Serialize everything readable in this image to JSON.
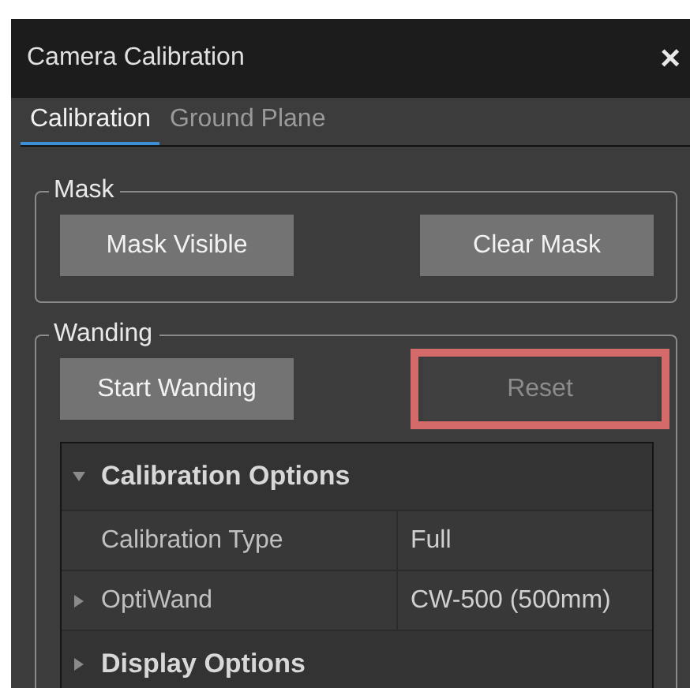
{
  "window": {
    "title": "Camera Calibration",
    "close": "×"
  },
  "tabs": [
    {
      "label": "Calibration",
      "selected": true
    },
    {
      "label": "Ground Plane",
      "selected": false
    }
  ],
  "groups": [
    {
      "title": "Mask",
      "buttons": [
        {
          "label": "Mask Visible",
          "disabled": false,
          "highlighted": false
        },
        {
          "label": "Clear Mask",
          "disabled": false,
          "highlighted": false
        }
      ]
    },
    {
      "title": "Wanding",
      "buttons": [
        {
          "label": "Start Wanding",
          "disabled": false,
          "highlighted": false
        },
        {
          "label": "Reset",
          "disabled": true,
          "highlighted": true
        }
      ],
      "properties": [
        {
          "kind": "category",
          "label": "Calibration Options",
          "expanded": true,
          "children": [
            {
              "kind": "property",
              "label": "Calibration Type",
              "value": "Full",
              "expandable": false
            },
            {
              "kind": "property",
              "label": "OptiWand",
              "value": "CW-500 (500mm)",
              "expandable": true
            }
          ]
        },
        {
          "kind": "category",
          "label": "Display Options",
          "expanded": false
        }
      ]
    }
  ]
}
